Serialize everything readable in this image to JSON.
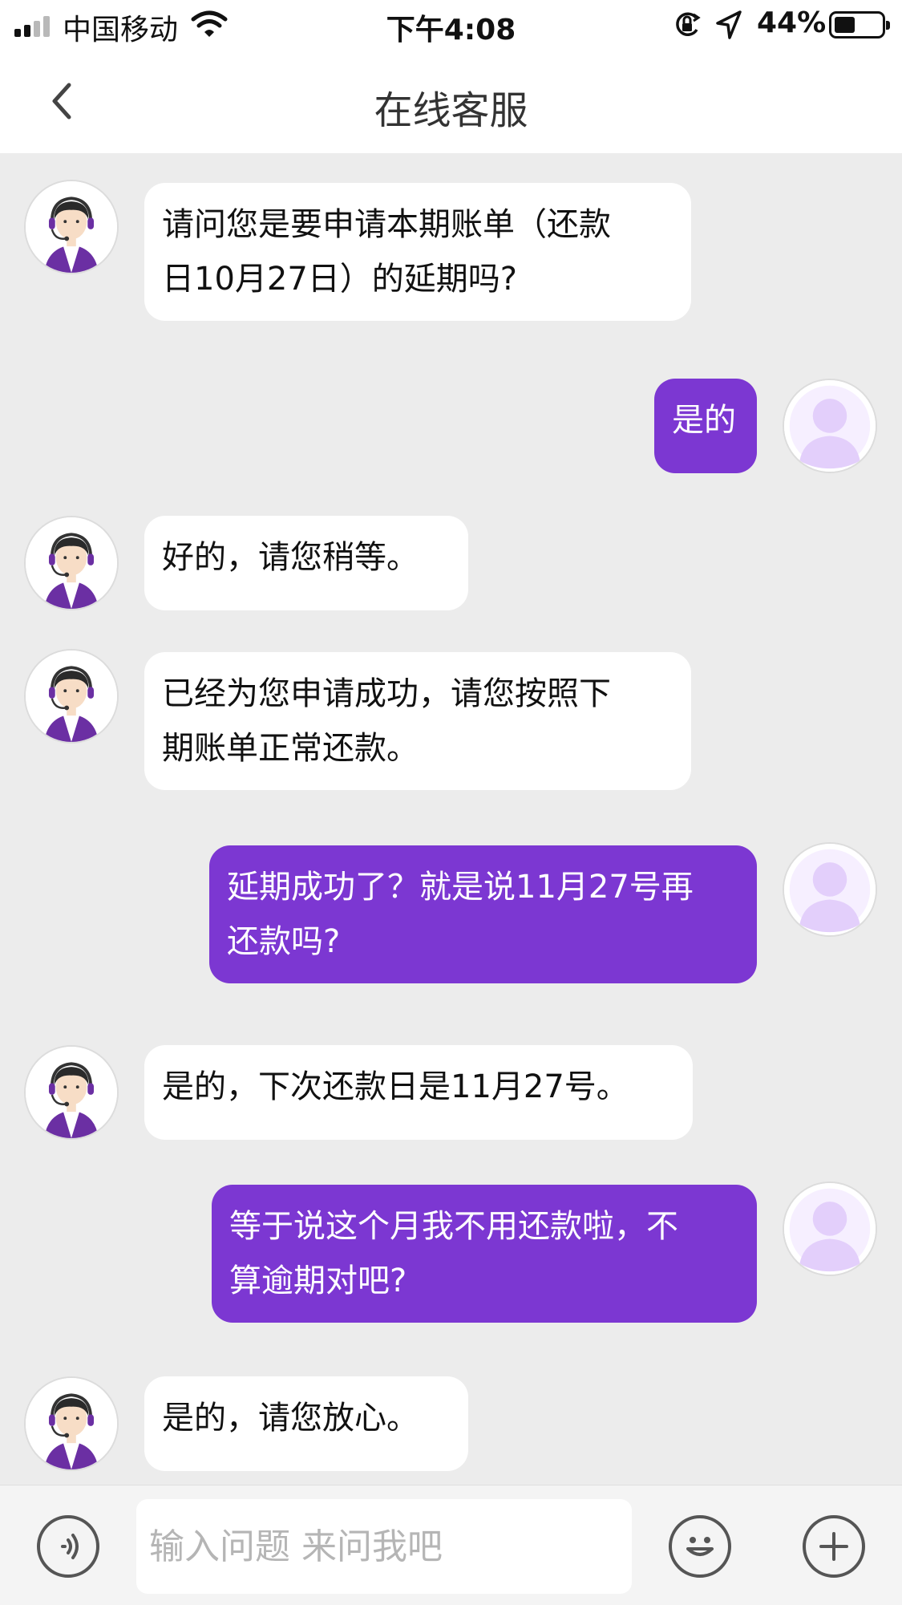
{
  "status_bar": {
    "carrier": "中国移动",
    "time": "下午4:08",
    "battery_percent": "44%",
    "battery_level": 0.44
  },
  "header": {
    "title": "在线客服"
  },
  "messages": [
    {
      "sender": "agent",
      "line1": "请问您是要申请本期账单（还款",
      "line2": "日10月27日）的延期吗?"
    },
    {
      "sender": "user",
      "line1": "是的"
    },
    {
      "sender": "agent",
      "line1": "好的，请您稍等。"
    },
    {
      "sender": "agent",
      "line1": "已经为您申请成功，请您按照下",
      "line2": "期账单正常还款。"
    },
    {
      "sender": "user",
      "line1": "延期成功了？就是说11月27号再",
      "line2": "还款吗?"
    },
    {
      "sender": "agent",
      "line1": "是的，下次还款日是11月27号。"
    },
    {
      "sender": "user",
      "line1": "等于说这个月我不用还款啦，不",
      "line2": "算逾期对吧?"
    },
    {
      "sender": "agent",
      "line1": "是的，请您放心。"
    }
  ],
  "input": {
    "placeholder": "输入问题 来问我吧",
    "value": ""
  },
  "icons": {
    "back": "chevron-left-icon",
    "voice": "voice-icon",
    "emoji": "emoji-icon",
    "plus": "plus-icon"
  },
  "colors": {
    "user_bubble": "#7c37d2",
    "agent_bubble": "#ffffff",
    "chat_background": "#ececec",
    "user_avatar": "#e6d3fb"
  }
}
